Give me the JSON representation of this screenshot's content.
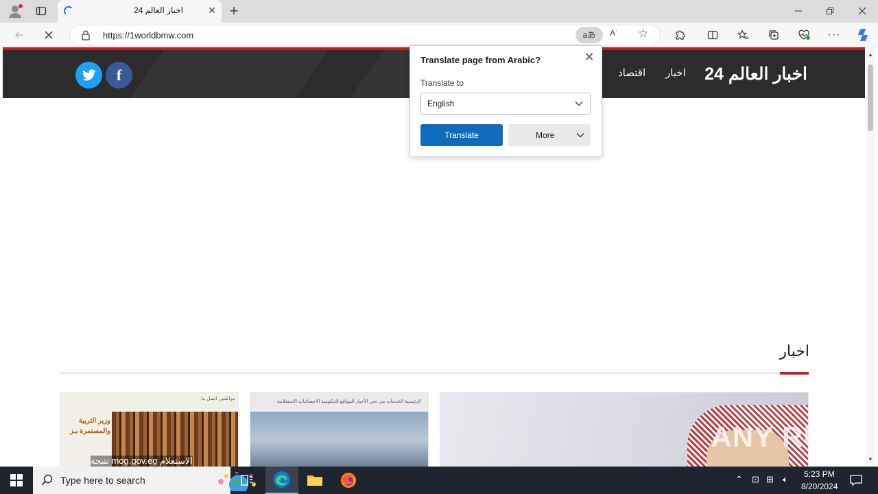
{
  "browser": {
    "tab": {
      "title": "اخبار العالم 24"
    },
    "address": {
      "url": "https://1worldbmw.com"
    },
    "translate_chip_label": "aあ",
    "read_aloud_label": "Aʾ"
  },
  "site": {
    "logo": "اخبار العالم 24",
    "nav": [
      "اخبار",
      "اقتصاد"
    ],
    "section_title": "اخبار",
    "cards": [
      {
        "nav": "مواطنين     اتصل بنا",
        "headline": "وزير التربية والمستمرة بـز",
        "caption": "الاستعلام mog.gov.eg نتيجة"
      },
      {
        "nav": "الرئيسية   الخدمات   من نحن   الأخبار   المواقع الحكومية   الاحصائيات   الاستعلامة"
      },
      {}
    ],
    "watermark": "ANY RUN",
    "colors": {
      "accent": "#c21f1f",
      "header_bg": "#2c2c2c",
      "twitter": "#1da1f2",
      "facebook": "#3b5998"
    }
  },
  "translate_popup": {
    "title": "Translate page from Arabic?",
    "label": "Translate to",
    "selected_language": "English",
    "translate_button": "Translate",
    "more_button": "More",
    "colors": {
      "primary": "#0f6cbd"
    }
  },
  "taskbar": {
    "search_placeholder": "Type here to search",
    "clock": {
      "time": "5:23 PM",
      "date": "8/20/2024"
    }
  }
}
